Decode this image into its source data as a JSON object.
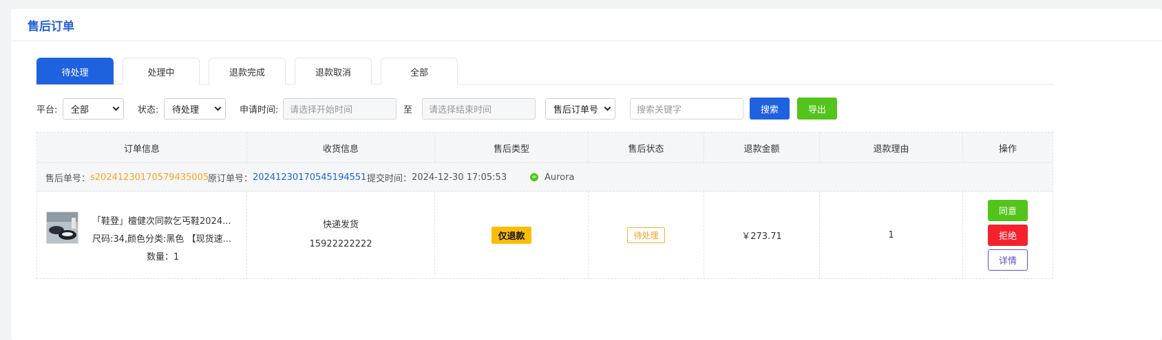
{
  "page": {
    "title": "售后订单"
  },
  "tabs": [
    {
      "label": "待处理",
      "active": true
    },
    {
      "label": "处理中",
      "active": false
    },
    {
      "label": "退款完成",
      "active": false
    },
    {
      "label": "退款取消",
      "active": false
    },
    {
      "label": "全部",
      "active": false
    }
  ],
  "filters": {
    "platform_label": "平台:",
    "platform_value": "全部",
    "status_label": "状态:",
    "status_value": "待处理",
    "time_label": "申请时间:",
    "start_placeholder": "请选择开始时间",
    "to_label": "至",
    "end_placeholder": "请选择结束时间",
    "search_field_value": "售后订单号",
    "keyword_placeholder": "搜索关键字",
    "search_button": "搜索",
    "export_button": "导出"
  },
  "table": {
    "headers": [
      "订单信息",
      "收货信息",
      "售后类型",
      "售后状态",
      "退款金额",
      "退款理由",
      "操作"
    ],
    "order": {
      "after_sale_no_label": "售后单号：",
      "after_sale_no": "s20241230170579435005",
      "original_no_label": "原订单号：",
      "original_no": "20241230170545194551",
      "submit_time_label": "提交时间：",
      "submit_time": "2024-12-30 17:05:53",
      "shop_icon": "link-icon",
      "shop_name": "Aurora",
      "product_title": "「鞋登」檀健次同款乞丐鞋2024...",
      "product_spec": "尺码:34,颜色分类:黑色 【现货速...",
      "product_qty": "数量：1",
      "shipping_method": "快递发货",
      "phone": "15922222222",
      "after_sale_type": "仅退款",
      "after_sale_status": "待处理",
      "refund_amount": "￥273.71",
      "refund_reason": "1",
      "actions": {
        "agree": "同意",
        "reject": "拒绝",
        "detail": "详情"
      }
    }
  },
  "colors": {
    "primary": "#1f62e0",
    "success": "#52c41a",
    "danger": "#f5222d",
    "warning": "#fbbd08",
    "order_no": "#f5a623"
  }
}
